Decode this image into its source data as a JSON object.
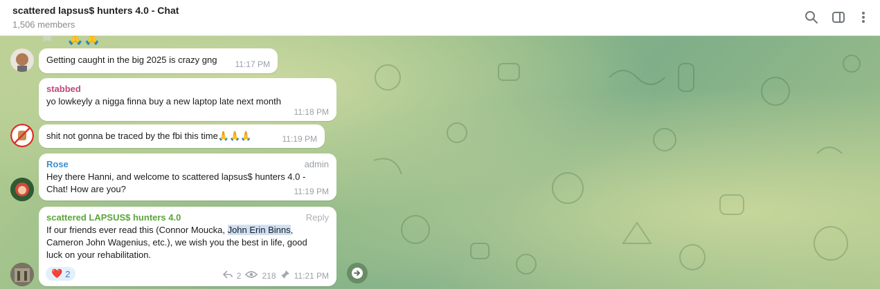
{
  "header": {
    "title": "scattered lapsus$ hunters 4.0 - Chat",
    "members": "1,506 members",
    "icons": [
      "search-icon",
      "sidebar-toggle-icon",
      "more-vertical-icon"
    ]
  },
  "messages": [
    {
      "sender": "",
      "text": "Getting caught in the big 2025 is crazy gng",
      "time": "11:17 PM"
    },
    {
      "sender": "stabbed",
      "sender_color": "#c2457a",
      "text": "yo lowkeyly a nigga finna buy a new laptop late next month",
      "time": "11:18 PM"
    },
    {
      "sender": "",
      "text": "shit not gonna be traced by the fbi this time🙏🙏🙏",
      "time": "11:19 PM"
    },
    {
      "sender": "Rose",
      "sender_color": "#3a8fd0",
      "role": "admin",
      "text": "Hey there Hanni, and welcome to scattered lapsus$ hunters 4.0 - Chat! How are you?",
      "time": "11:19 PM"
    },
    {
      "sender": "scattered LAPSUS$ hunters 4.0",
      "sender_color": "#5aa53a",
      "reply_label": "Reply",
      "text_before": "If our friends ever read this (Connor Moucka, ",
      "text_highlight": "John Erin Binns",
      "text_after": ", Cameron John Wagenius, etc.), we wish you the best in life, good luck on your rehabilitation.",
      "reaction_emoji": "❤️",
      "reaction_count": "2",
      "replies": "2",
      "views": "218",
      "time": "11:21 PM"
    }
  ],
  "top_emoji": "🙏🙏"
}
